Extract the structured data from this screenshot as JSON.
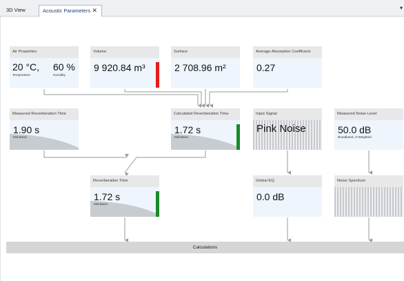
{
  "tabs": {
    "tab1": "3D View",
    "tab2": "Acoustic Parameters",
    "close_glyph": "✕",
    "menu_glyph": "▾"
  },
  "cards": {
    "air": {
      "title": "Air Properties",
      "temperature": "20 °C,",
      "temperature_label": "Temperature",
      "humidity": "60 %",
      "humidity_label": "Humidity"
    },
    "volume": {
      "title": "Volume",
      "value": "9 920.84 m³",
      "indicator_color": "#e51a1a"
    },
    "surface": {
      "title": "Surface",
      "value": "2 708.96 m²"
    },
    "absorption": {
      "title": "Average Absorption Coefficient",
      "value": "0.27"
    },
    "measured_rt": {
      "title": "Measured Reverberation Time",
      "value": "1.90  s",
      "sub": "Mid-Band"
    },
    "calculated_rt": {
      "title": "Calculated Reverberation Time",
      "value": "1.72  s",
      "sub": "Mid-Band",
      "indicator_color": "#1a8a2a"
    },
    "input_signal": {
      "title": "Input Signal",
      "value": "Pink Noise"
    },
    "noise_level": {
      "title": "Measured Noise Level",
      "value": "50.0  dB",
      "sub": "Broadband, Z-Weighted"
    },
    "reverb_time": {
      "title": "Reverberation Time",
      "value": "1.72  s",
      "sub": "Mid-Band",
      "indicator_color": "#1a8a2a"
    },
    "global_eq": {
      "title": "Global EQ",
      "value": "0.0  dB"
    },
    "noise_spectrum": {
      "title": "Noise Spectrum"
    }
  },
  "calculations": {
    "label": "Calculations"
  }
}
